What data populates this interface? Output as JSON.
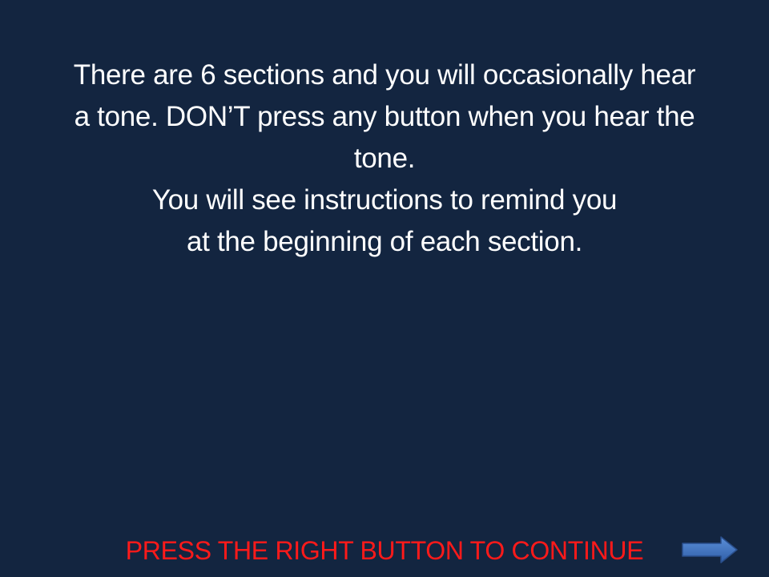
{
  "instructions": {
    "line1": "There are 6 sections and you will occasionally hear",
    "line2": "a tone. DON’T press any button when you hear the",
    "line3": "tone.",
    "line4": "You will see instructions to remind you",
    "line5": "at the beginning of each section."
  },
  "footer": {
    "continue_label": "PRESS THE RIGHT BUTTON TO CONTINUE",
    "arrow_icon": "right-arrow-icon"
  },
  "colors": {
    "background": "#132540",
    "text": "#ffffff",
    "prompt": "#ff1a1a",
    "arrow": "#3f74c4"
  }
}
